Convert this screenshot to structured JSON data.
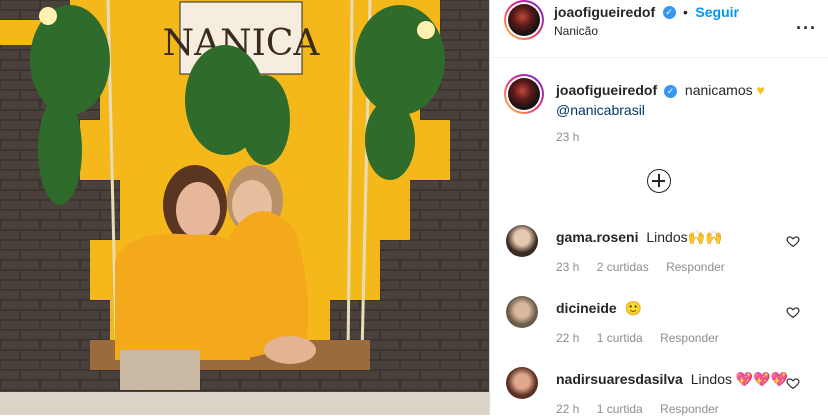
{
  "post": {
    "author": "joaofigueiredof",
    "follow_label": "Seguir",
    "location": "Nanicão",
    "sign_text": "NANICA",
    "caption_text": "nanicamos",
    "caption_mention": "@nanicabrasil",
    "timestamp": "23 h",
    "more_icon": "more-options-icon"
  },
  "colors": {
    "accent": "#0095f6",
    "verified": "#3897f0",
    "hoodie": "#f5b400",
    "meta": "#8e8e8e"
  },
  "comments": [
    {
      "user": "gama.roseni",
      "text": "Lindos",
      "emoji": "🙌🙌",
      "time": "23 h",
      "likes": "2 curtidas",
      "reply": "Responder"
    },
    {
      "user": "dicineide",
      "text": "",
      "emoji": "🙂",
      "time": "22 h",
      "likes": "1 curtida",
      "reply": "Responder"
    },
    {
      "user": "nadirsuaresdasilva",
      "text": "Lindos",
      "emoji": "💖💖💖",
      "time": "22 h",
      "likes": "1 curtida",
      "reply": "Responder"
    }
  ]
}
